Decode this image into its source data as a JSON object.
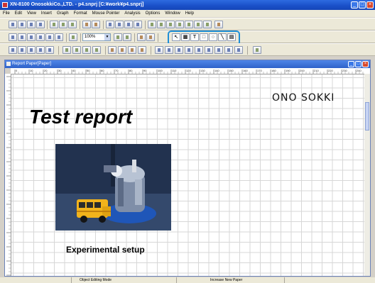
{
  "window": {
    "title": "XN-8100 OnosokkiCo.,LTD. - p4.snprj [C:¥work¥p4.snprj]"
  },
  "menu": [
    "File",
    "Edit",
    "View",
    "Insert",
    "Graph",
    "Format",
    "Mouse Pointer",
    "Analysis",
    "Options",
    "Window",
    "Help"
  ],
  "toolbar": {
    "zoom_value": "100%"
  },
  "document": {
    "title": "Report Paper[Paper]",
    "ruler_labels": [
      "0",
      "10",
      "20",
      "30",
      "40",
      "50",
      "60",
      "70",
      "80",
      "90",
      "100",
      "110",
      "120",
      "130",
      "140",
      "150",
      "160",
      "170",
      "180",
      "190",
      "200",
      "210",
      "220",
      "230",
      "240"
    ],
    "brand": "ONO SOKKI",
    "report_title": "Test report",
    "caption": "Experimental setup"
  },
  "status": {
    "mode": "Object Editing Mode",
    "action": "Increase New Paper"
  },
  "colors": {
    "titlebar": "#1a4fc7",
    "highlight": "#1f8fd6",
    "grid": "#d7d7d7"
  }
}
